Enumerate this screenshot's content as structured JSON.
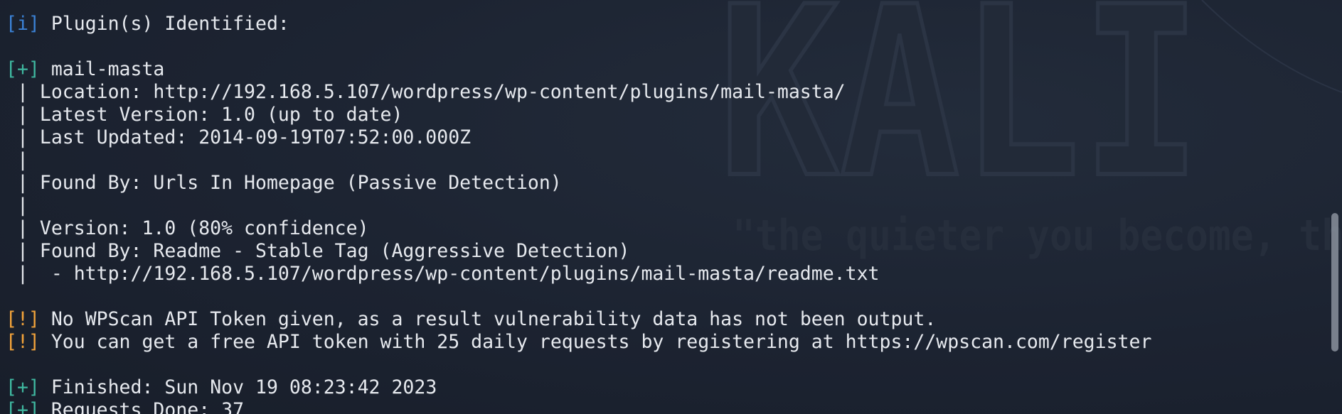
{
  "wallpaper": {
    "logo_text": "KALI L",
    "tagline": "\"the quieter you become, th"
  },
  "terminal": {
    "lines": [
      {
        "tag": "[i]",
        "tag_kind": "info",
        "text": " Plugin(s) Identified:"
      },
      {
        "tag": "",
        "tag_kind": "",
        "text": ""
      },
      {
        "tag": "[+]",
        "tag_kind": "plus",
        "text": " mail-masta"
      },
      {
        "tag": "",
        "tag_kind": "",
        "text": " | Location: http://192.168.5.107/wordpress/wp-content/plugins/mail-masta/"
      },
      {
        "tag": "",
        "tag_kind": "",
        "text": " | Latest Version: 1.0 (up to date)"
      },
      {
        "tag": "",
        "tag_kind": "",
        "text": " | Last Updated: 2014-09-19T07:52:00.000Z"
      },
      {
        "tag": "",
        "tag_kind": "",
        "text": " |"
      },
      {
        "tag": "",
        "tag_kind": "",
        "text": " | Found By: Urls In Homepage (Passive Detection)"
      },
      {
        "tag": "",
        "tag_kind": "",
        "text": " |"
      },
      {
        "tag": "",
        "tag_kind": "",
        "text": " | Version: 1.0 (80% confidence)"
      },
      {
        "tag": "",
        "tag_kind": "",
        "text": " | Found By: Readme - Stable Tag (Aggressive Detection)"
      },
      {
        "tag": "",
        "tag_kind": "",
        "text": " |  - http://192.168.5.107/wordpress/wp-content/plugins/mail-masta/readme.txt"
      },
      {
        "tag": "",
        "tag_kind": "",
        "text": ""
      },
      {
        "tag": "[!]",
        "tag_kind": "warn",
        "text": " No WPScan API Token given, as a result vulnerability data has not been output."
      },
      {
        "tag": "[!]",
        "tag_kind": "warn",
        "text": " You can get a free API token with 25 daily requests by registering at https://wpscan.com/register"
      },
      {
        "tag": "",
        "tag_kind": "",
        "text": ""
      },
      {
        "tag": "[+]",
        "tag_kind": "plus",
        "text": " Finished: Sun Nov 19 08:23:42 2023"
      },
      {
        "tag": "[+]",
        "tag_kind": "plus",
        "text": " Requests Done: 37"
      }
    ]
  },
  "colors": {
    "background": "#1c2331",
    "text": "#e6e9ee",
    "info_tag": "#3b82d6",
    "plus_tag": "#3fb8a0",
    "warn_tag": "#f2a33a"
  }
}
